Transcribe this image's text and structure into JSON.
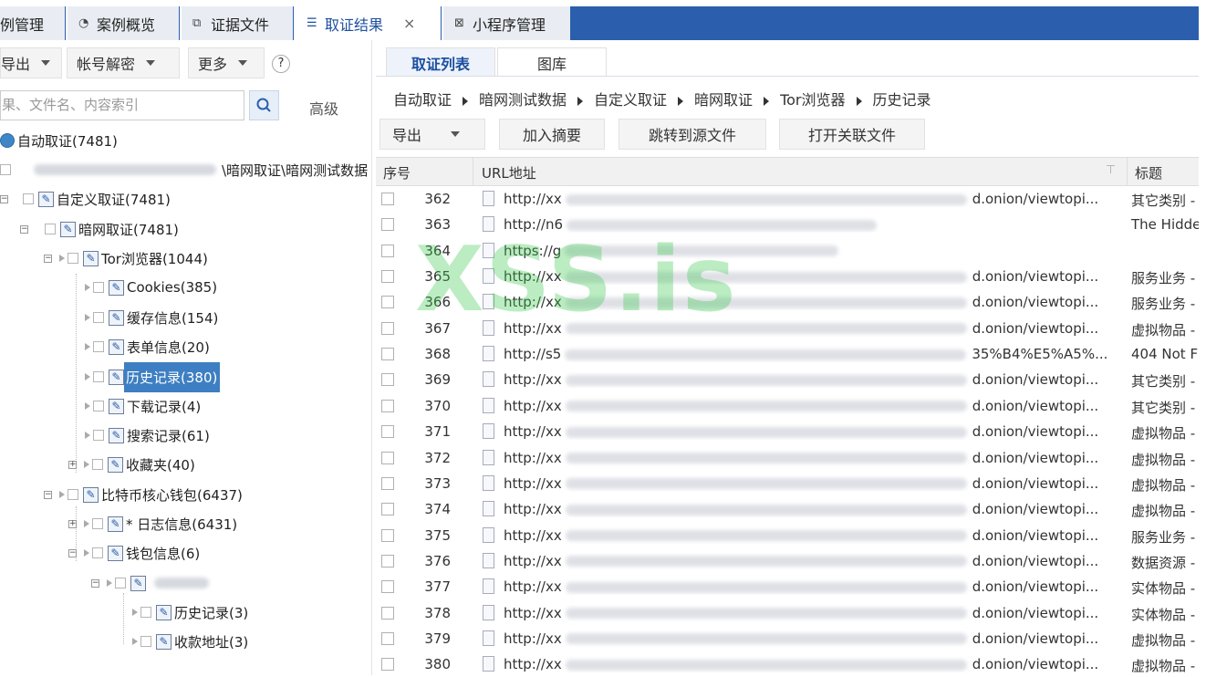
{
  "top_tabs": [
    {
      "label": "案例管理",
      "icon": "briefcase-icon"
    },
    {
      "label": "案例概览",
      "icon": "chart-icon"
    },
    {
      "label": "证据文件",
      "icon": "files-icon"
    },
    {
      "label": "取证结果",
      "icon": "list-icon",
      "close": "×"
    },
    {
      "label": "小程序管理",
      "icon": "miniapp-icon"
    }
  ],
  "left_toolbar": {
    "export": "导出",
    "decrypt": "帐号解密",
    "more": "更多",
    "help": "?"
  },
  "search": {
    "placeholder": "结果、文件名、内容索引",
    "advanced": "高级"
  },
  "tree": {
    "root": "自动取证(7481)",
    "path_suffix": "\\暗网取证\\暗网测试数据",
    "custom": "自定义取证(7481)",
    "darkweb": "暗网取证(7481)",
    "tor": "Tor浏览器(1044)",
    "cookies": "Cookies(385)",
    "cache": "缓存信息(154)",
    "forms": "表单信息(20)",
    "history": "历史记录(380)",
    "downloads": "下载记录(4)",
    "searches": "搜索记录(61)",
    "favorites": "收藏夹(40)",
    "bitcoin": "比特币核心钱包(6437)",
    "log": "* 日志信息(6431)",
    "wallet": "钱包信息(6)",
    "wallet_history": "历史记录(3)",
    "wallet_addr": "收款地址(3)"
  },
  "right_tabs": {
    "list": "取证列表",
    "gallery": "图库"
  },
  "breadcrumb": [
    "自动取证",
    "暗网测试数据",
    "自定义取证",
    "暗网取证",
    "Tor浏览器",
    "历史记录"
  ],
  "right_toolbar": {
    "export": "导出",
    "add_summary": "加入摘要",
    "goto_source": "跳转到源文件",
    "open_related": "打开关联文件"
  },
  "columns": {
    "seq": "序号",
    "url": "URL地址",
    "title": "标题"
  },
  "rows": [
    {
      "seq": "362",
      "url_start": "http://xx",
      "url_end": "d.onion/viewtopi...",
      "title": "其它类别 -"
    },
    {
      "seq": "363",
      "url_start": "http://n6",
      "url_end": "",
      "title": "The Hidde"
    },
    {
      "seq": "364",
      "url_start": "https://g",
      "url_end": "",
      "title": ""
    },
    {
      "seq": "365",
      "url_start": "http://xx",
      "url_end": "d.onion/viewtopi...",
      "title": "服务业务 -"
    },
    {
      "seq": "366",
      "url_start": "http://xx",
      "url_end": "d.onion/viewtopi...",
      "title": "服务业务 -"
    },
    {
      "seq": "367",
      "url_start": "http://xx",
      "url_end": "d.onion/viewtopi...",
      "title": "虚拟物品 -"
    },
    {
      "seq": "368",
      "url_start": "http://s5",
      "url_end": "35%B4%E5%A5%...",
      "title": "404 Not F"
    },
    {
      "seq": "369",
      "url_start": "http://xx",
      "url_end": "d.onion/viewtopi...",
      "title": "其它类别 -"
    },
    {
      "seq": "370",
      "url_start": "http://xx",
      "url_end": "d.onion/viewtopi...",
      "title": "其它类别 -"
    },
    {
      "seq": "371",
      "url_start": "http://xx",
      "url_end": "d.onion/viewtopi...",
      "title": "虚拟物品 -"
    },
    {
      "seq": "372",
      "url_start": "http://xx",
      "url_end": "d.onion/viewtopi...",
      "title": "虚拟物品 -"
    },
    {
      "seq": "373",
      "url_start": "http://xx",
      "url_end": "d.onion/viewtopi...",
      "title": "虚拟物品 -"
    },
    {
      "seq": "374",
      "url_start": "http://xx",
      "url_end": "d.onion/viewtopi...",
      "title": "虚拟物品 -"
    },
    {
      "seq": "375",
      "url_start": "http://xx",
      "url_end": "d.onion/viewtopi...",
      "title": "服务业务 -"
    },
    {
      "seq": "376",
      "url_start": "http://xx",
      "url_end": "d.onion/viewtopi...",
      "title": "数据资源 -"
    },
    {
      "seq": "377",
      "url_start": "http://xx",
      "url_end": "d.onion/viewtopi...",
      "title": "实体物品 -"
    },
    {
      "seq": "378",
      "url_start": "http://xx",
      "url_end": "d.onion/viewtopi...",
      "title": "实体物品 -"
    },
    {
      "seq": "379",
      "url_start": "http://xx",
      "url_end": "d.onion/viewtopi...",
      "title": "虚拟物品 -"
    },
    {
      "seq": "380",
      "url_start": "http://xx",
      "url_end": "d.onion/viewtopi...",
      "title": "虚拟物品 -"
    }
  ],
  "watermark": "XSS.is",
  "colors": {
    "accent": "#2b5fad",
    "selected": "#3d7fc2",
    "watermark": "#3cc850"
  }
}
